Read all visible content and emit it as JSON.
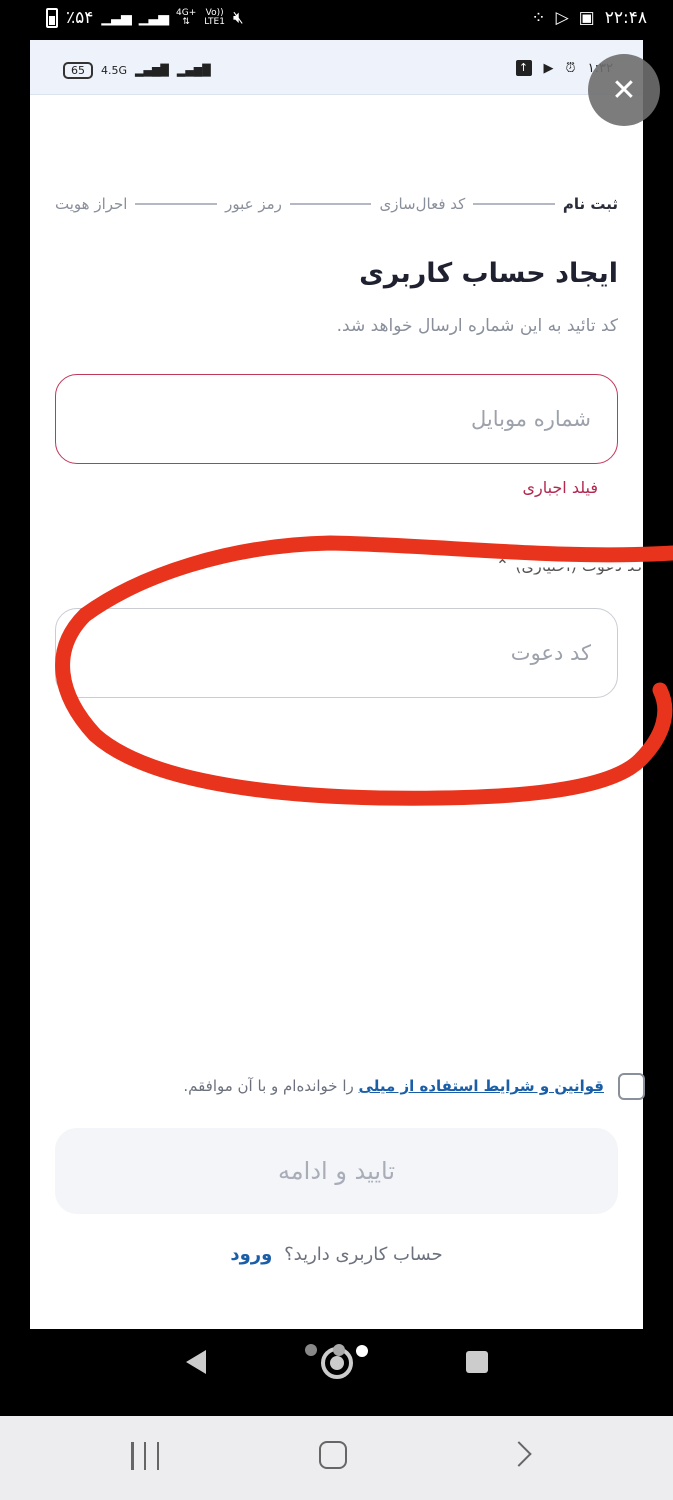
{
  "outer_status_bar": {
    "battery_percent": "٪۵۴",
    "network_type": "4G+",
    "volte": "Vo))",
    "lte": "LTE1",
    "time": "۲۲:۴۸"
  },
  "inner_status_bar": {
    "battery": "65",
    "network": "4.5G",
    "time": "۱:۳۲"
  },
  "stepper": {
    "steps": [
      "ثبت نام",
      "کد فعال‌سازی",
      "رمز عبور",
      "احراز هویت"
    ],
    "active_index": 0
  },
  "form": {
    "title": "ایجاد حساب کاربری",
    "subtitle": "کد تائید به این شماره ارسال خواهد شد.",
    "mobile_placeholder": "شماره موبایل",
    "mobile_value": "",
    "mobile_error": "فیلد اجباری",
    "invite_toggle_label": "کد دعوت (اختیاری)",
    "invite_placeholder": "کد دعوت",
    "invite_value": ""
  },
  "terms": {
    "link_text": "قوانین و شرایط استفاده از میلی",
    "suffix": "را خوانده‌ام و با آن موافقم.",
    "checked": false
  },
  "actions": {
    "submit_label": "تایید و ادامه",
    "login_prompt": "حساب کاربری دارید؟",
    "login_link": "ورود"
  },
  "colors": {
    "error": "#c0395b",
    "link": "#1a5ea8",
    "annotation": "#e8341c",
    "disabled_button_bg": "#f4f5f9"
  }
}
